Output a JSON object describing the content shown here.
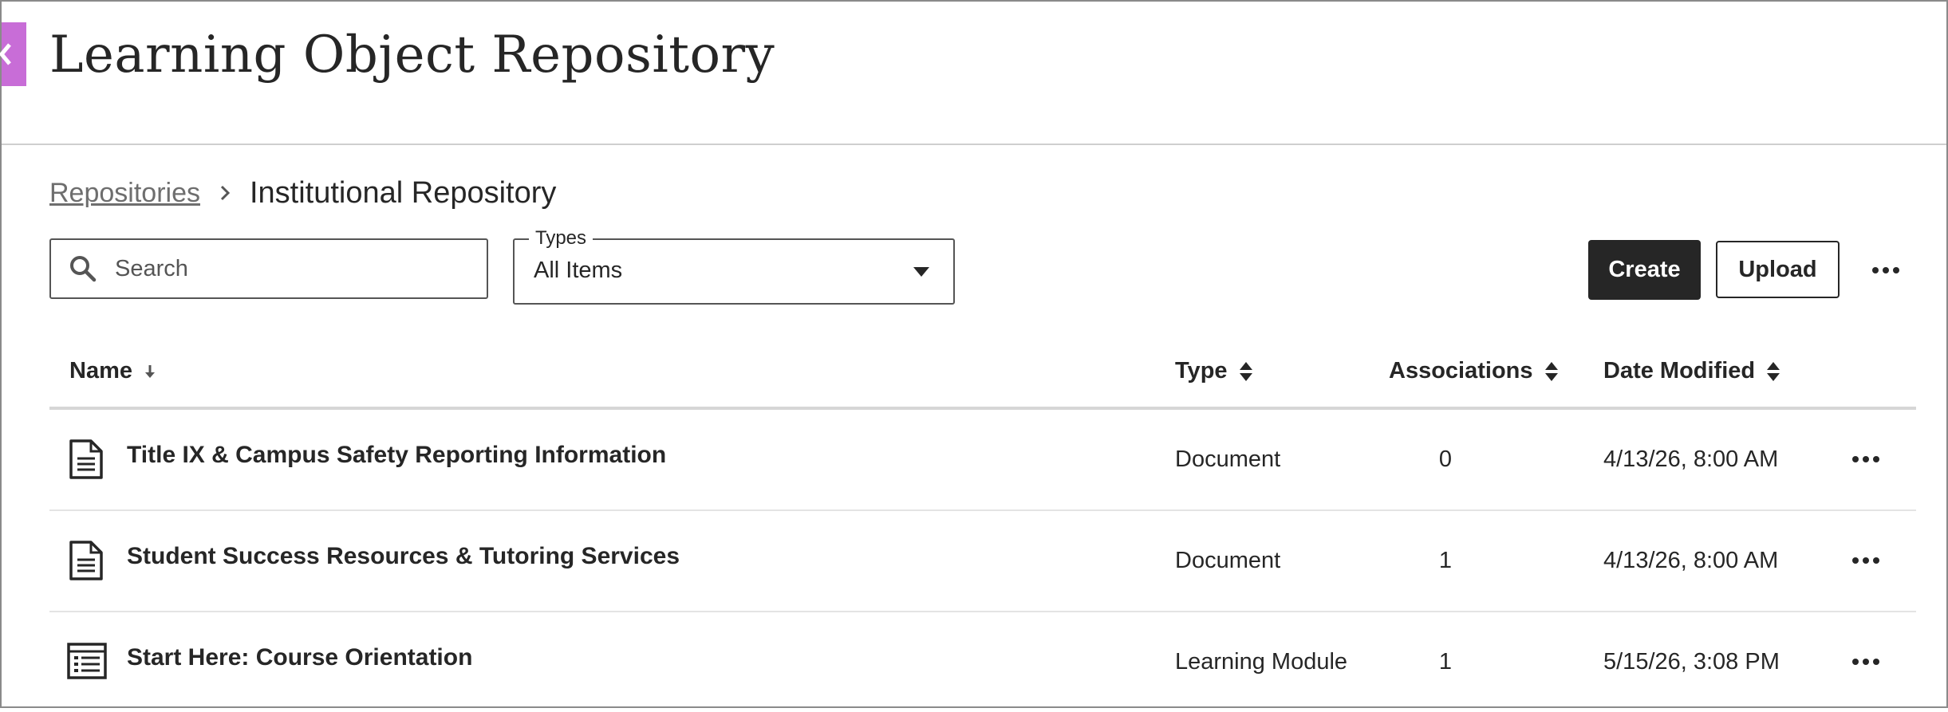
{
  "header": {
    "title": "Learning Object Repository"
  },
  "breadcrumb": {
    "parent": "Repositories",
    "current": "Institutional Repository"
  },
  "search": {
    "placeholder": "Search",
    "value": ""
  },
  "types_filter": {
    "label": "Types",
    "selected": "All Items"
  },
  "toolbar": {
    "create_label": "Create",
    "upload_label": "Upload"
  },
  "table": {
    "columns": {
      "name": "Name",
      "type": "Type",
      "associations": "Associations",
      "date_modified": "Date Modified"
    },
    "rows": [
      {
        "icon": "document-icon",
        "name": "Title IX & Campus Safety Reporting Information",
        "type": "Document",
        "associations": "0",
        "date_modified": "4/13/26, 8:00 AM"
      },
      {
        "icon": "document-icon",
        "name": "Student Success Resources & Tutoring Services",
        "type": "Document",
        "associations": "1",
        "date_modified": "4/13/26, 8:00 AM"
      },
      {
        "icon": "learning-module-icon",
        "name": "Start Here: Course Orientation",
        "type": "Learning Module",
        "associations": "1",
        "date_modified": "5/15/26, 3:08 PM"
      }
    ]
  },
  "colors": {
    "accent": "#c86dd7",
    "primary_button": "#262626",
    "text": "#262626",
    "muted_link": "#6e6e6e"
  }
}
